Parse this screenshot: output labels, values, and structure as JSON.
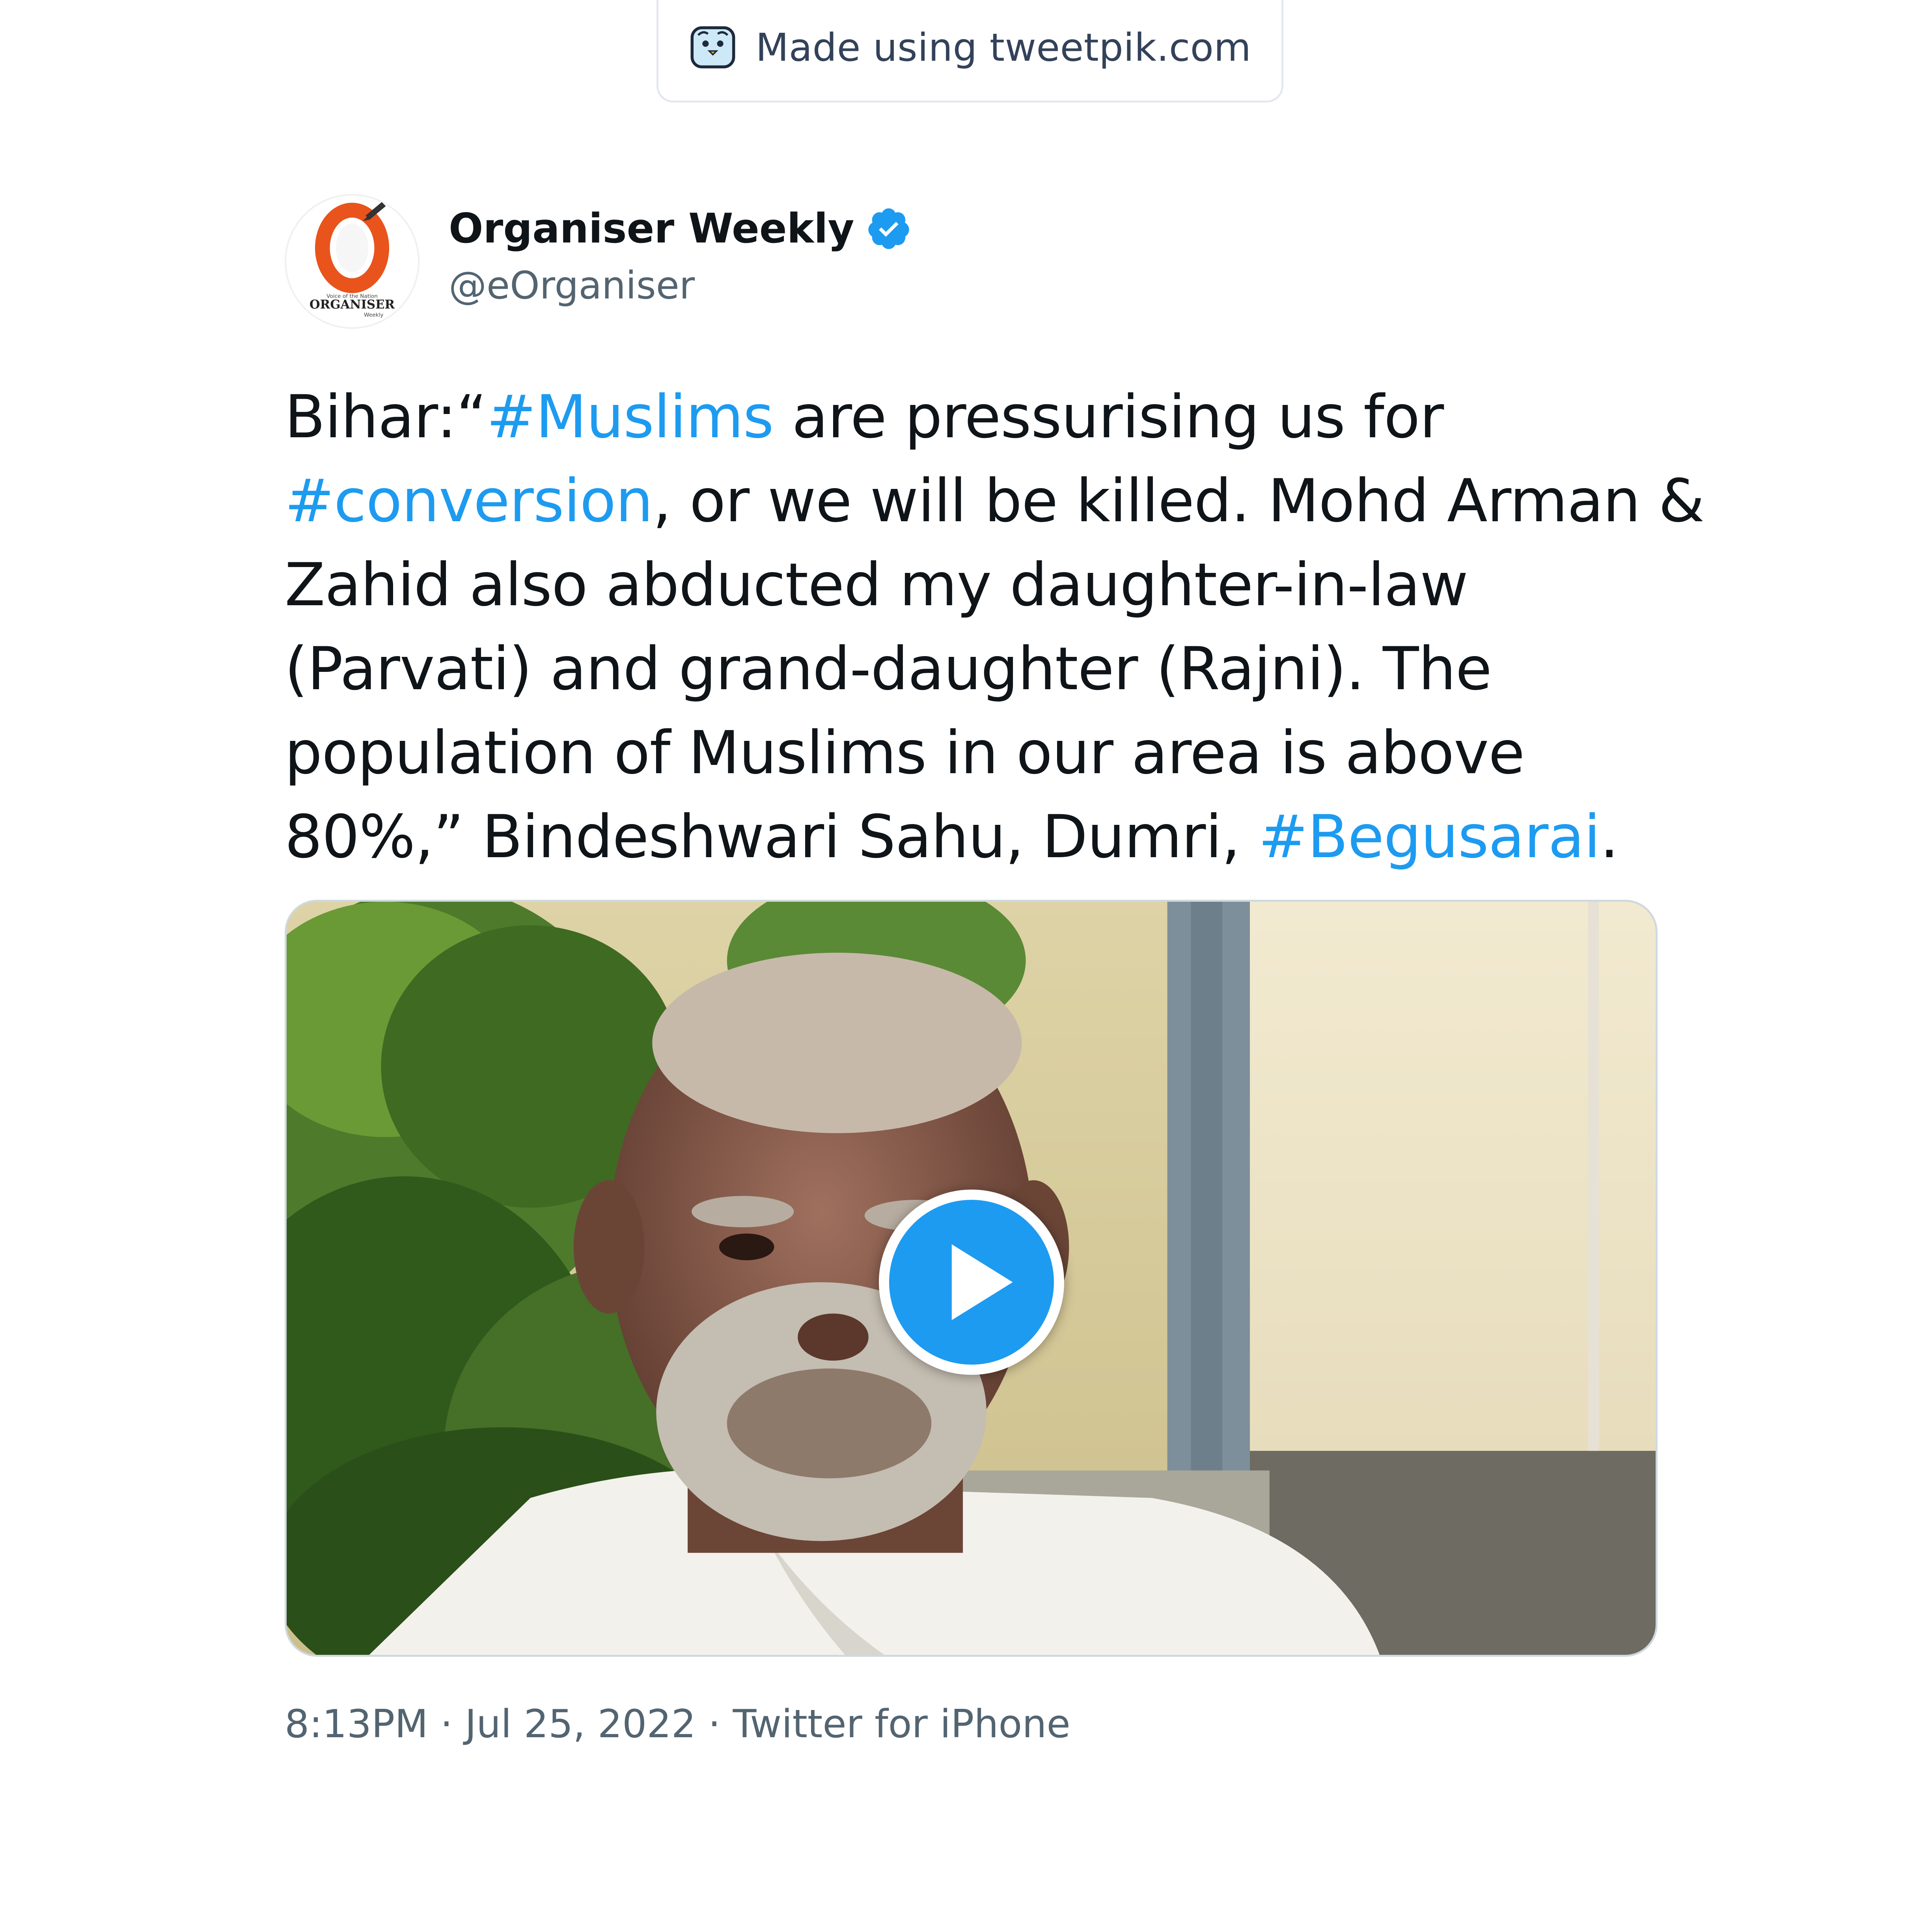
{
  "watermark": {
    "text": "Made using tweetpik.com",
    "icon": "tweetpik-logo-icon"
  },
  "author": {
    "name": "Organiser Weekly",
    "handle": "@eOrganiser",
    "verified": true,
    "avatar_icon": "organiser-logo-icon",
    "avatar_text": "ORGANISER",
    "avatar_subtext": "Weekly",
    "avatar_tagline": "Voice of the Nation"
  },
  "tweet": {
    "lines": [
      [
        {
          "t": "Bihar:“"
        },
        {
          "t": "#Muslims",
          "tag": true
        },
        {
          "t": " are pressurising us for"
        }
      ],
      [
        {
          "t": "#conversion",
          "tag": true
        },
        {
          "t": ", or we will be killed. Mohd Arman &"
        }
      ],
      [
        {
          "t": "Zahid also abducted my daughter-in-law"
        }
      ],
      [
        {
          "t": "(Parvati) and grand-daughter (Rajni). The"
        }
      ],
      [
        {
          "t": "population of Muslims in our area is above"
        }
      ],
      [
        {
          "t": "80%,” Bindeshwari Sahu, Dumri, "
        },
        {
          "t": "#Begusarai",
          "tag": true
        },
        {
          "t": "."
        }
      ]
    ]
  },
  "media": {
    "type": "video",
    "play_icon": "play-icon"
  },
  "meta": {
    "time": "8:13PM",
    "date": "Jul 25, 2022",
    "source": "Twitter for iPhone",
    "separator": " · "
  },
  "colors": {
    "hashtag": "#1d9bf0",
    "secondary": "#536471",
    "text": "#0f1419"
  }
}
